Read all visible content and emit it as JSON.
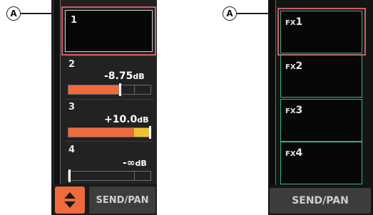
{
  "callouts": {
    "left": "A",
    "right": "A"
  },
  "left_panel": {
    "channels": [
      {
        "number": "1",
        "level": "",
        "unit": ""
      },
      {
        "number": "2",
        "level": "-8.75",
        "unit": "dB",
        "meter": {
          "fill_fraction": 0.62,
          "cursor_fraction": 0.62
        }
      },
      {
        "number": "3",
        "level": "+10.0",
        "unit": "dB",
        "meter": {
          "fill_fraction": 0.79,
          "peak_fraction": 0.98,
          "cursor_fraction": 0.98
        }
      },
      {
        "number": "4",
        "level": "-∞",
        "unit": "dB",
        "meter": {
          "fill_fraction": 0.0,
          "cursor_fraction": 0.0
        }
      }
    ],
    "sort_button": {
      "icon": "up-down-arrows-icon",
      "color": "#ef6a3c"
    },
    "send_pan_label": "SEND/PAN"
  },
  "right_panel": {
    "fx_slots": [
      {
        "prefix": "FX",
        "number": "1"
      },
      {
        "prefix": "FX",
        "number": "2"
      },
      {
        "prefix": "FX",
        "number": "3"
      },
      {
        "prefix": "FX",
        "number": "4"
      }
    ],
    "send_pan_label": "SEND/PAN"
  },
  "colors": {
    "accent_orange": "#ef6a3c",
    "peak_yellow": "#f2c12e",
    "fx_border_green": "#31b48b",
    "highlight_red": "#d65a62"
  }
}
